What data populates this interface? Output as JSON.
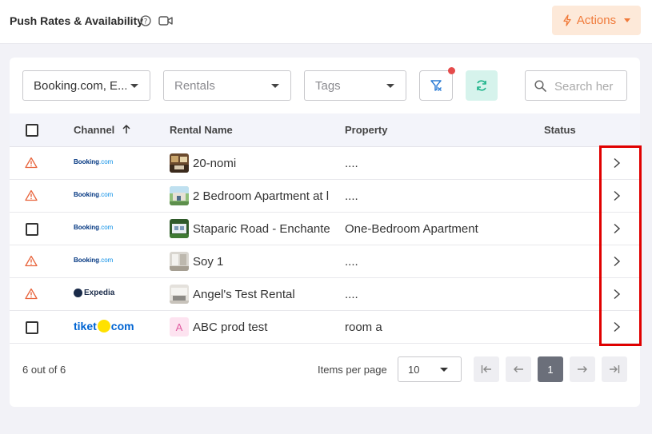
{
  "header": {
    "title": "Push Rates & Availability",
    "actions_label": "Actions"
  },
  "filters": {
    "channel_value": "Booking.com, E...",
    "rentals_placeholder": "Rentals",
    "tags_placeholder": "Tags",
    "search_placeholder": "Search her"
  },
  "table": {
    "columns": {
      "channel": "Channel",
      "rental_name": "Rental Name",
      "property": "Property",
      "status": "Status"
    },
    "rows": [
      {
        "indicator": "warning-icon",
        "channel": "booking",
        "rental": "20-nomi",
        "property": "....",
        "thumb": "photo"
      },
      {
        "indicator": "warning-icon",
        "channel": "booking",
        "rental": "2 Bedroom Apartment at l",
        "property": "....",
        "thumb": "photo"
      },
      {
        "indicator": "checkbox",
        "channel": "booking",
        "rental": "Staparic Road - Enchante",
        "property": "One-Bedroom Apartment",
        "thumb": "photo"
      },
      {
        "indicator": "warning-icon",
        "channel": "booking",
        "rental": "Soy 1",
        "property": "....",
        "thumb": "photo"
      },
      {
        "indicator": "warning-icon",
        "channel": "expedia",
        "rental": "Angel's Test Rental",
        "property": "....",
        "thumb": "photo"
      },
      {
        "indicator": "checkbox",
        "channel": "tiket",
        "rental": "ABC prod test",
        "property": "room a",
        "thumb": "A"
      }
    ]
  },
  "channel_logos": {
    "booking_main": "Booking",
    "booking_suffix": ".com",
    "expedia": "Expedia",
    "tiket_main": "tiket",
    "tiket_suffix": "com"
  },
  "footer": {
    "count_text": "6 out of 6",
    "items_per_page_label": "Items per page",
    "items_per_page_value": "10",
    "current_page": "1"
  },
  "colors": {
    "accent_orange": "#f07a3a",
    "actions_bg": "#fde9d9",
    "refresh_bg": "#d6f3ec",
    "warning": "#e8643c",
    "highlight_border": "#e00000"
  }
}
